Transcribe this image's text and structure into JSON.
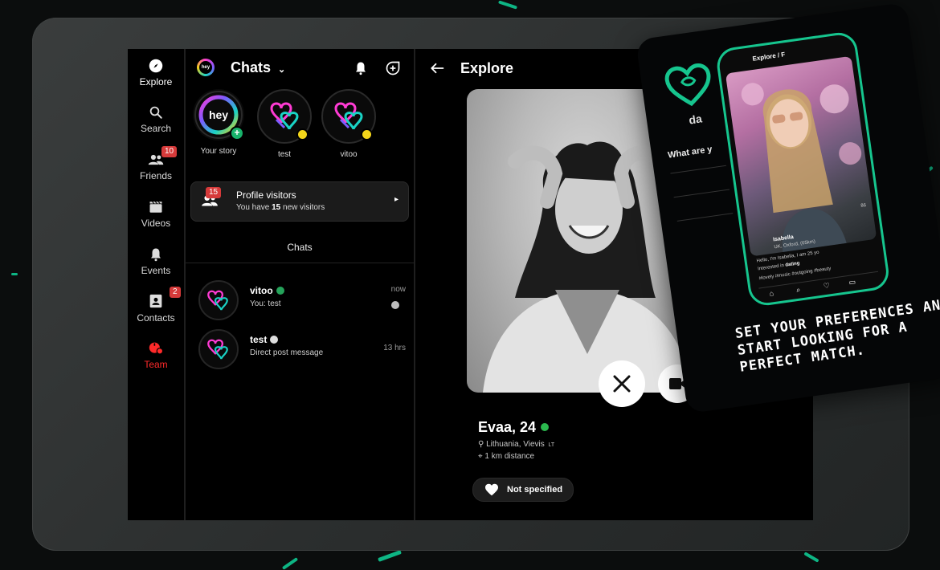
{
  "sidebar": {
    "items": [
      {
        "label": "Explore",
        "icon": "compass-icon"
      },
      {
        "label": "Search",
        "icon": "search-icon"
      },
      {
        "label": "Friends",
        "icon": "friends-icon",
        "badge": "10"
      },
      {
        "label": "Videos",
        "icon": "clapperboard-icon"
      },
      {
        "label": "Events",
        "icon": "bell-icon"
      },
      {
        "label": "Contacts",
        "icon": "contacts-icon",
        "badge": "2"
      },
      {
        "label": "Team",
        "icon": "team-icon"
      }
    ]
  },
  "chats": {
    "logo": "hey",
    "title": "Chats",
    "stories": [
      {
        "label": "Your story"
      },
      {
        "label": "test"
      },
      {
        "label": "vitoo"
      }
    ],
    "visitors": {
      "badge": "15",
      "title": "Profile visitors",
      "text_prefix": "You have ",
      "count": "15",
      "text_suffix": " new visitors"
    },
    "section_label": "Chats",
    "list": [
      {
        "name": "vitoo",
        "message": "You: test",
        "time": "now"
      },
      {
        "name": "test",
        "message": "Direct post message",
        "time": "13 hrs"
      }
    ]
  },
  "explore": {
    "title": "Explore",
    "profile": {
      "name": "Evaa, 24",
      "location": "Lithuania, Vievis",
      "country_code": "LT",
      "distance": "1 km distance",
      "preference": "Not specified"
    }
  },
  "promo": {
    "brand": "da",
    "phone_title": "Explore / F",
    "question": "What are y",
    "bio_name": "Isabella",
    "bio_location": "UK, Oxford, (65km)",
    "bio_line1": "Hello, I'm Isabella, I am 25 yo",
    "bio_line2_prefix": "Interested in ",
    "bio_line2_value": "dating",
    "tags": "#lovely #music #outgoing #beauty",
    "likes": "86",
    "tagline": "SET YOUR PREFERENCES AND START LOOKING FOR A PERFECT MATCH."
  },
  "colors": {
    "accent_green": "#16c58e",
    "badge_red": "#d63a3a",
    "team_red": "#ff2a2a",
    "online_green": "#2bb84e",
    "purple": "#7c4dff"
  }
}
